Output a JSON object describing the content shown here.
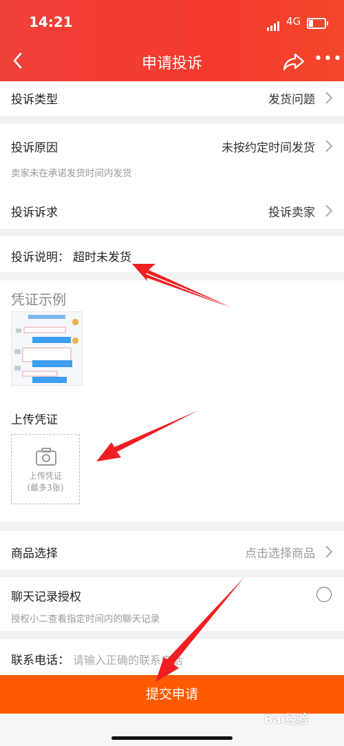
{
  "status_bar": {
    "time": "14:21",
    "network": "4G"
  },
  "nav": {
    "title": "申请投诉"
  },
  "rows": {
    "type": {
      "label": "投诉类型",
      "value": "发货问题"
    },
    "reason": {
      "label": "投诉原因",
      "value": "未按约定时间发货",
      "note": "卖家未在承诺发货时间内发货"
    },
    "demand": {
      "label": "投诉诉求",
      "value": "投诉卖家"
    },
    "desc": {
      "label": "投诉说明：",
      "value": "超时未发货"
    }
  },
  "evidence": {
    "example_title": "凭证示例",
    "upload_title": "上传凭证",
    "upload_line1": "上传凭证",
    "upload_line2": "(最多3张)"
  },
  "product": {
    "label": "商品选择",
    "placeholder": "点击选择商品"
  },
  "chat": {
    "label": "聊天记录授权",
    "note": "授权小二查看指定时间内的聊天记录"
  },
  "phone": {
    "label": "联系电话：",
    "placeholder": "请输入正确的联系电话"
  },
  "submit_label": "提交申请",
  "watermark": "Bai经验",
  "colors": {
    "header": "#f53a2e",
    "submit": "#ff5a00",
    "annotation_arrow": "#ef1f22"
  }
}
